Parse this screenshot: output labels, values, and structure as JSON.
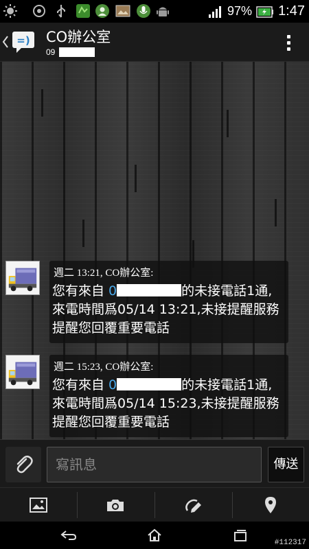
{
  "status_bar": {
    "battery_percent": "97%",
    "time": "1:47",
    "icons": [
      "brightness-icon",
      "sync-icon",
      "usb-icon",
      "app-icon",
      "contacts-app-icon",
      "image-icon",
      "mic-icon",
      "android-icon",
      "signal-icon",
      "battery-icon"
    ]
  },
  "header": {
    "title": "CO辦公室",
    "subtitle_visible": "09",
    "icons": [
      "back-chevron-icon",
      "messaging-app-icon",
      "overflow-menu-icon"
    ]
  },
  "messages": [
    {
      "meta": "週二 13:21, CO辦公室:",
      "pre": "您有來自 ",
      "phone_prefix": "0",
      "post": "的未接電話1通,來電時間爲05/14 13:21,未接提醒服務提醒您回覆重要電話",
      "avatar": "truck-avatar-icon"
    },
    {
      "meta": "週二 15:23, CO辦公室:",
      "pre": "您有來自 ",
      "phone_prefix": "0",
      "post": "的未接電話1通,來電時間爲05/14 15:23,未接提醒服務提醒您回覆重要電話",
      "avatar": "truck-avatar-icon"
    }
  ],
  "compose": {
    "placeholder": "寫訊息",
    "send_label": "傳送"
  },
  "media_toolbar": [
    "picture-icon",
    "camera-icon",
    "sketch-icon",
    "location-pin-icon"
  ],
  "nav_bar": [
    "back-icon",
    "home-icon",
    "recents-icon"
  ],
  "watermark": "#112317",
  "colors": {
    "link": "#4aa8e8",
    "status_green": "#3cb043"
  }
}
